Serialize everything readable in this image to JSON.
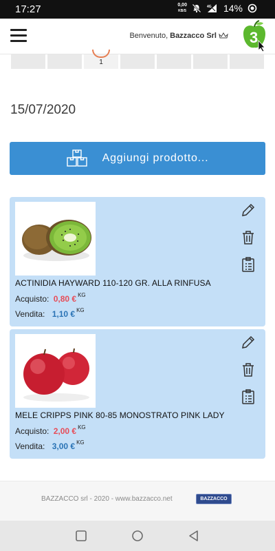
{
  "status_bar": {
    "time": "17:27",
    "net_speed_value": "0,00",
    "net_speed_unit": "KB/S",
    "signal_label": "4G",
    "battery": "14%"
  },
  "header": {
    "welcome": "Benvenuto,",
    "company": "Bazzacco Srl",
    "logo_number": "3",
    "icons": [
      "menu-icon",
      "crown-icon",
      "app-logo"
    ]
  },
  "steps": {
    "active_number": "1"
  },
  "date": "15/07/2020",
  "add_product_label": "Aggiungi prodotto...",
  "products": [
    {
      "name": "ACTINIDIA HAYWARD 110-120 GR. ALLA RINFUSA",
      "buy_label": "Acquisto:",
      "buy_price": "0,80 €",
      "sell_label": "Vendita:",
      "sell_price": "1,10 €",
      "unit": "KG"
    },
    {
      "name": "MELE CRIPPS PINK 80-85 MONOSTRATO PINK LADY",
      "buy_label": "Acquisto:",
      "buy_price": "2,00 €",
      "sell_label": "Vendita:",
      "sell_price": "3,00 €",
      "unit": "KG"
    }
  ],
  "footer": {
    "text": "BAZZACCO srl - 2020 - www.bazzacco.net",
    "brand": "BAZZACCO"
  },
  "colors": {
    "accent_blue": "#3a8fd3",
    "card_bg": "#c4dff7",
    "buy_red": "#e74c57",
    "sell_blue": "#2a73b5",
    "logo_green": "#5cb82e"
  }
}
